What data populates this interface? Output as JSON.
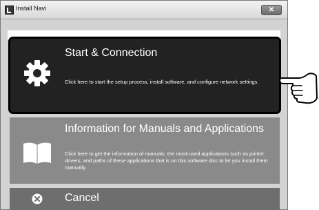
{
  "window": {
    "title": "Install Navi",
    "close_label": "✕"
  },
  "options": {
    "start": {
      "title": "Start & Connection",
      "description": "Click here to start the setup process, install software, and configure network settings."
    },
    "info": {
      "title": "Information for Manuals and Applications",
      "description": "Click here to get the information of manuals, the most-used applications such as printer drivers, and paths of these applications that is on this software disc to let you install them manually."
    },
    "cancel": {
      "title": "Cancel"
    }
  },
  "icons": {
    "app": "install-navi-icon",
    "start": "gear-icon",
    "info": "book-icon",
    "cancel": "close-circle-icon",
    "pointer": "pointing-hand-icon"
  },
  "colors": {
    "start_bg": "#222222",
    "info_bg": "#8a8a8a",
    "cancel_bg": "#6e6e6e",
    "panel_bg": "#d3d3d3"
  }
}
